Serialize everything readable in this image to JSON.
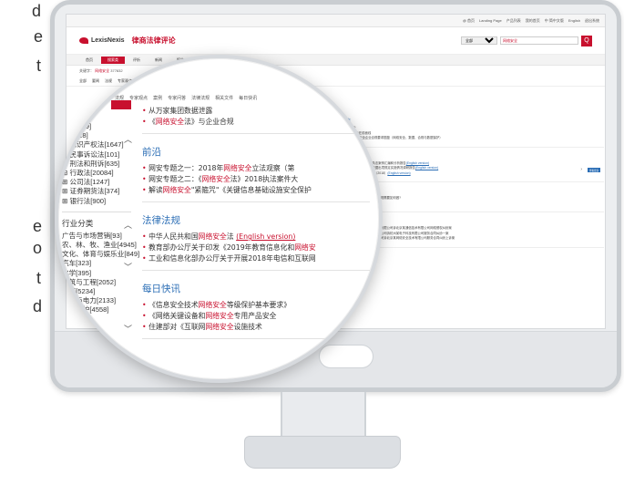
{
  "side_letters": [
    "d",
    "e",
    "t",
    "e",
    "o",
    "t",
    "d"
  ],
  "site": {
    "logo_text": "LexisNexis",
    "title": "律商法律评论",
    "topbar_links": [
      "@ 首页",
      "Landing Page",
      "产品列表",
      "我的首页",
      "中 简中文版",
      "English",
      "退出系统"
    ],
    "search": {
      "scope": "全部",
      "query": "网络安全",
      "button": "Q"
    },
    "nav": [
      "首页",
      "搜索类",
      "评析",
      "新闻",
      "报告",
      "新闻聚合",
      "用户中心"
    ],
    "crumb_label": "关键字：",
    "crumb_value": "网络安全",
    "crumb_count": "377832",
    "subnav": [
      "全部",
      "要闻",
      "法规",
      "专家观点",
      "案例",
      "专家问答",
      "法律法规",
      "相关文件",
      "每日快讯"
    ]
  },
  "right_panel": [
    {
      "title": "聚焦",
      "lines": [
        [
          "• 网安行业",
          ""
        ],
        [
          "• GDPR，走在前面线",
          ""
        ],
        [
          "• 新时期网络安全企业合规要求图鉴（网络安全、数据、合规与数据保护）",
          ""
        ]
      ],
      "more": "查看更多"
    },
    {
      "title": "报告",
      "lines": [
        [
          "• 2018《网络安全法》执法案例汇编和分析报告",
          "(English version)"
        ],
        [
          "• 2018《网络安全法》数据出境规定实施情况调研报告",
          "(English version)"
        ],
        [
          "• 中国数据保护年度报告（2018）",
          "(English version)"
        ]
      ],
      "more": "查看更多"
    },
    {
      "title": "专家问答",
      "lines": [
        [
          "• 网络安全宣传周期间企业合规需要如何做?",
          ""
        ],
        [
          "• 数字加密是指?",
          ""
        ]
      ],
      "more": "查看更多"
    },
    {
      "title": "判决文书",
      "lines": [
        [
          "• 北京市海淀区网络安全技术有限公司诉北京某通信技术有限公司网络侵权纠纷案",
          ""
        ],
        [
          "• 杭州市某网络安全技术有限公司诉杭州某电子科技有限公司服务合同纠纷一案",
          ""
        ],
        [
          "• 北京某通信网络技术有限公司诉北京某网络安全技术有限公司服务合同纠纷上诉案",
          ""
        ]
      ],
      "more": "查看更多"
    }
  ],
  "magnifier": {
    "top_tabs": [
      "全部",
      "要闻",
      "法规",
      "专家观点",
      "案例",
      "专家问答",
      "法律法规",
      "相关文件",
      "每日快讯"
    ],
    "category_list": [
      "家法[349]",
      "法[1728]",
      "⊞ 知识产权法[1647]",
      "⊞ 民事诉讼法[101]",
      "⊞ 刑法和刑诉[635]",
      "⊞ 行政法[20084]",
      "⊞ 公司法[1247]",
      "⊞ 证券期货法[374]",
      "⊞ 银行法[900]"
    ],
    "industry_heading": "行业分类",
    "industry_list": [
      "广告与市场营销[93]",
      "农、林、牧、渔业[4945]",
      "文化、体育与娱乐业[849]",
      "汽车[323]",
      "化学[395]",
      "建筑与工程[2052]",
      "教育[5234]",
      "能源与电力[2133]",
      "环境保护[4558]"
    ],
    "sections": [
      {
        "title": "",
        "items": [
          {
            "pre": "从万家集团数据泄露",
            "hl": "",
            "post": "",
            "link": ""
          },
          {
            "pre": "《",
            "hl": "网络安全",
            "post": "法》与企业合规",
            "link": ""
          }
        ]
      },
      {
        "title": "前沿",
        "items": [
          {
            "pre": "网安专题之一：2018年",
            "hl": "网络安全",
            "post": "立法观察（第",
            "link": ""
          },
          {
            "pre": "网安专题之二：《",
            "hl": "网络安全",
            "post": "法》2018执法案件大",
            "link": ""
          },
          {
            "pre": "解读",
            "hl": "网络安全",
            "post": "\"紧箍咒\"《关键信息基础设施安全保护",
            "link": ""
          }
        ]
      },
      {
        "title": "法律法规",
        "items": [
          {
            "pre": "中华人民共和国",
            "hl": "网络安全",
            "post": "法 ",
            "link": "(English version)"
          },
          {
            "pre": "教育部办公厅关于印发《2019年教育信息化和",
            "hl": "网络安",
            "post": "",
            "link": ""
          },
          {
            "pre": "工业和信息化部办公厅关于开展2018年电信和互联网",
            "hl": "",
            "post": "",
            "link": ""
          }
        ]
      },
      {
        "title": "每日快讯",
        "items": [
          {
            "pre": "《信息安全技术",
            "hl": "网络安全",
            "post": "等级保护基本要求》",
            "link": ""
          },
          {
            "pre": "《网络关键设备和",
            "hl": "网络安全",
            "post": "专用产品安全",
            "link": ""
          },
          {
            "pre": "住建部对《互联网",
            "hl": "网络安全",
            "post": "设施技术",
            "link": ""
          }
        ]
      }
    ]
  },
  "colors": {
    "brand_red": "#c8102e",
    "link_blue": "#2a6db5",
    "frame_gray": "#c9cdd1"
  }
}
